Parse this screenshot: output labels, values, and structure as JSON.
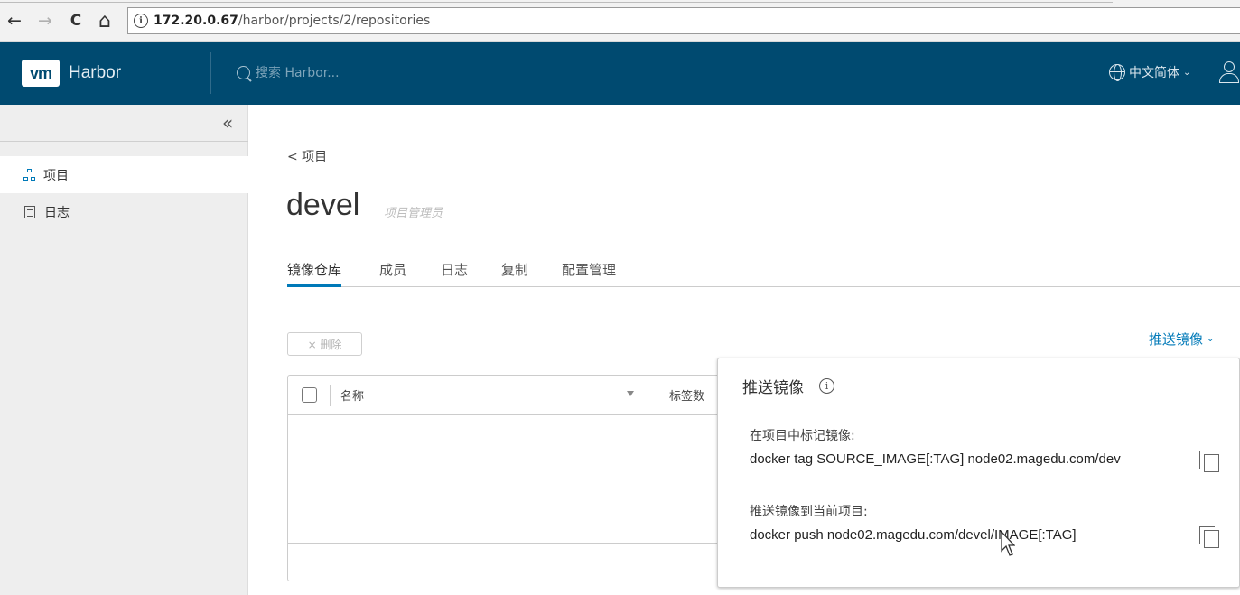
{
  "browser": {
    "back_glyph": "←",
    "forward_glyph": "→",
    "reload_glyph": "C",
    "home_glyph": "⌂",
    "info_glyph": "i",
    "url_host": "172.20.0.67",
    "url_path": "/harbor/projects/2/repositories"
  },
  "header": {
    "logo_text": "vm",
    "brand": "Harbor",
    "search_placeholder": "搜索 Harbor...",
    "language": "中文简体",
    "language_chevron": "⌄",
    "bg_color": "#004a70"
  },
  "sidebar": {
    "collapse_glyph": "«",
    "items": [
      {
        "label": "项目",
        "icon": "project-icon",
        "active": true
      },
      {
        "label": "日志",
        "icon": "log-icon",
        "active": false
      }
    ]
  },
  "main": {
    "breadcrumb": "< 项目",
    "title": "devel",
    "role": "项目管理员",
    "tabs": [
      {
        "label": "镜像仓库",
        "active": true
      },
      {
        "label": "成员",
        "active": false
      },
      {
        "label": "日志",
        "active": false
      },
      {
        "label": "复制",
        "active": false
      },
      {
        "label": "配置管理",
        "active": false
      }
    ],
    "delete_button": "× 删除",
    "push_dropdown": "推送镜像",
    "grid": {
      "columns": [
        "名称",
        "标签数"
      ]
    }
  },
  "popover": {
    "title": "推送镜像",
    "info_glyph": "i",
    "tag_label": "在项目中标记镜像:",
    "tag_command": "docker tag SOURCE_IMAGE[:TAG] node02.magedu.com/dev",
    "push_label": "推送镜像到当前项目:",
    "push_command": "docker push node02.magedu.com/devel/IMAGE[:TAG]"
  },
  "colors": {
    "accent": "#0079b8"
  }
}
